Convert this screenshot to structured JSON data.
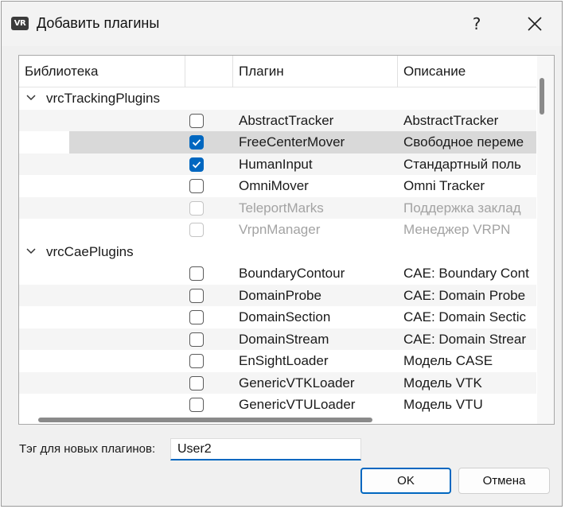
{
  "window": {
    "title": "Добавить плагины",
    "icon_text": "VR",
    "help_label": "?",
    "close_icon": "close-icon"
  },
  "table": {
    "headers": {
      "library": "Библиотека",
      "plugin": "Плагин",
      "description": "Описание"
    },
    "categories": [
      {
        "name": "vrcTrackingPlugins",
        "expanded": true
      },
      {
        "name": "vrcCaePlugins",
        "expanded": true
      }
    ],
    "rows": [
      {
        "plugin": "AbstractTracker",
        "description": "AbstractTracker",
        "checked": false,
        "enabled": true
      },
      {
        "plugin": "FreeCenterMover",
        "description": "Свободное переме",
        "checked": true,
        "enabled": true,
        "selected": true
      },
      {
        "plugin": "HumanInput",
        "description": "Стандартный поль",
        "checked": true,
        "enabled": true
      },
      {
        "plugin": "OmniMover",
        "description": "Omni Tracker",
        "checked": false,
        "enabled": true
      },
      {
        "plugin": "TeleportMarks",
        "description": "Поддержка заклад",
        "checked": false,
        "enabled": false
      },
      {
        "plugin": "VrpnManager",
        "description": "Менеджер VRPN",
        "checked": false,
        "enabled": false
      },
      {
        "plugin": "BoundaryContour",
        "description": "CAE: Boundary Cont",
        "checked": false,
        "enabled": true
      },
      {
        "plugin": "DomainProbe",
        "description": "CAE: Domain Probe",
        "checked": false,
        "enabled": true
      },
      {
        "plugin": "DomainSection",
        "description": "CAE: Domain Sectic",
        "checked": false,
        "enabled": true
      },
      {
        "plugin": "DomainStream",
        "description": "CAE: Domain Strear",
        "checked": false,
        "enabled": true
      },
      {
        "plugin": "EnSightLoader",
        "description": "Модель CASE",
        "checked": false,
        "enabled": true
      },
      {
        "plugin": "GenericVTKLoader",
        "description": "Модель VTK",
        "checked": false,
        "enabled": true
      },
      {
        "plugin": "GenericVTULoader",
        "description": "Модель VTU",
        "checked": false,
        "enabled": true
      }
    ]
  },
  "tag": {
    "label": "Тэг для новых плагинов:",
    "value": "User2"
  },
  "buttons": {
    "ok": "OK",
    "cancel": "Отмена"
  },
  "colors": {
    "accent": "#0067c0",
    "disabled_text": "#a3a3a3",
    "selection": "#d9d9d9"
  }
}
